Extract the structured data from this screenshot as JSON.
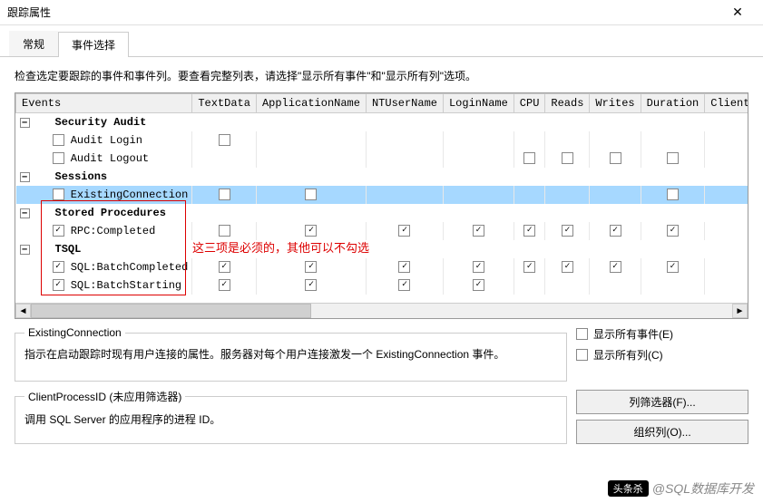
{
  "window": {
    "title": "跟踪属性",
    "close": "✕"
  },
  "tabs": {
    "general": "常规",
    "events": "事件选择"
  },
  "instruction": "检查选定要跟踪的事件和事件列。要查看完整列表，请选择\"显示所有事件\"和\"显示所有列\"选项。",
  "columns": [
    "Events",
    "TextData",
    "ApplicationName",
    "NTUserName",
    "LoginName",
    "CPU",
    "Reads",
    "Writes",
    "Duration",
    "ClientProcessID"
  ],
  "rows": [
    {
      "type": "group",
      "label": "Security Audit"
    },
    {
      "type": "event",
      "label": "Audit Login",
      "self": false,
      "checks": [
        false,
        null,
        null,
        null,
        null,
        null,
        null,
        null,
        false
      ]
    },
    {
      "type": "event",
      "label": "Audit Logout",
      "self": false,
      "checks": [
        null,
        null,
        null,
        null,
        false,
        false,
        false,
        false,
        false
      ]
    },
    {
      "type": "group",
      "label": "Sessions"
    },
    {
      "type": "event",
      "label": "ExistingConnection",
      "self": false,
      "selected": true,
      "checks": [
        false,
        false,
        null,
        null,
        null,
        null,
        null,
        false,
        false
      ]
    },
    {
      "type": "group",
      "label": "Stored Procedures"
    },
    {
      "type": "event",
      "label": "RPC:Completed",
      "self": true,
      "checks": [
        false,
        true,
        true,
        true,
        true,
        true,
        true,
        true,
        true
      ]
    },
    {
      "type": "group",
      "label": "TSQL"
    },
    {
      "type": "event",
      "label": "SQL:BatchCompleted",
      "self": true,
      "checks": [
        true,
        true,
        true,
        true,
        true,
        true,
        true,
        true,
        true
      ]
    },
    {
      "type": "event",
      "label": "SQL:BatchStarting",
      "self": true,
      "checks": [
        true,
        true,
        true,
        true,
        null,
        null,
        null,
        null,
        true
      ]
    }
  ],
  "annotation": "这三项是必须的，其他可以不勾选",
  "help1": {
    "title": "ExistingConnection",
    "desc": "指示在启动跟踪时现有用户连接的属性。服务器对每个用户连接激发一个 ExistingConnection 事件。"
  },
  "help2": {
    "title": "ClientProcessID (未应用筛选器)",
    "desc": "调用 SQL Server 的应用程序的进程 ID。"
  },
  "showAllEvents": "显示所有事件(E)",
  "showAllCols": "显示所有列(C)",
  "btnFilter": "列筛选器(F)...",
  "btnOrganize": "组织列(O)...",
  "wm": {
    "badge": "头条杀",
    "text": "@SQL数据库开发"
  }
}
